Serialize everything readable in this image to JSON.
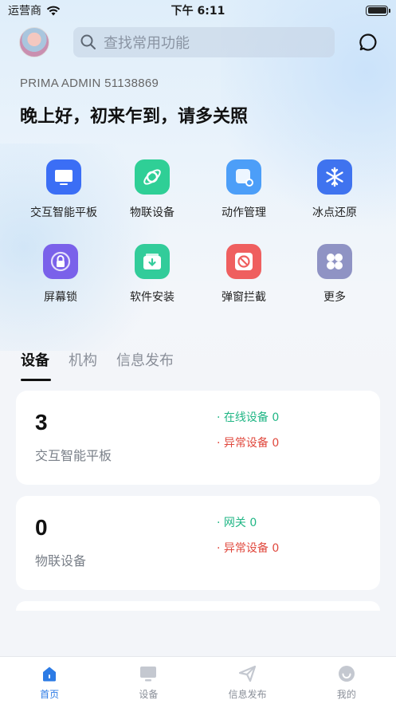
{
  "status_bar": {
    "carrier": "运营商",
    "time": "下午 6:11"
  },
  "header": {
    "search_placeholder": "查找常用功能"
  },
  "user": {
    "id_line": "PRIMA ADMIN 51138869",
    "greeting": "晚上好，初来乍到，请多关照"
  },
  "grid": [
    {
      "label": "交互智能平板",
      "icon": "tablet-icon",
      "color": "#3b6ef5"
    },
    {
      "label": "物联设备",
      "icon": "iot-icon",
      "color": "#2fcf96"
    },
    {
      "label": "动作管理",
      "icon": "action-settings-icon",
      "color": "#4c9ef8"
    },
    {
      "label": "冰点还原",
      "icon": "snowflake-icon",
      "color": "#3f73ef"
    },
    {
      "label": "屏幕锁",
      "icon": "screen-lock-icon",
      "color": "#7a61ea"
    },
    {
      "label": "软件安装",
      "icon": "software-install-icon",
      "color": "#32cc9a"
    },
    {
      "label": "弹窗拦截",
      "icon": "popup-block-icon",
      "color": "#ef5f5f"
    },
    {
      "label": "更多",
      "icon": "more-grid-icon",
      "color": "#8f93c4"
    }
  ],
  "tabs": [
    "设备",
    "机构",
    "信息发布"
  ],
  "cards": [
    {
      "count": "3",
      "name": "交互智能平板",
      "stat1": "· 在线设备 0",
      "stat2": "· 异常设备 0"
    },
    {
      "count": "0",
      "name": "物联设备",
      "stat1": "· 网关 0",
      "stat2": "· 异常设备 0"
    }
  ],
  "tabbar": [
    {
      "label": "首页",
      "icon": "home-icon"
    },
    {
      "label": "设备",
      "icon": "monitor-icon"
    },
    {
      "label": "信息发布",
      "icon": "send-icon"
    },
    {
      "label": "我的",
      "icon": "user-icon"
    }
  ],
  "colors": {
    "accent": "#2c7be5",
    "green": "#20b685",
    "red": "#e0483d"
  }
}
